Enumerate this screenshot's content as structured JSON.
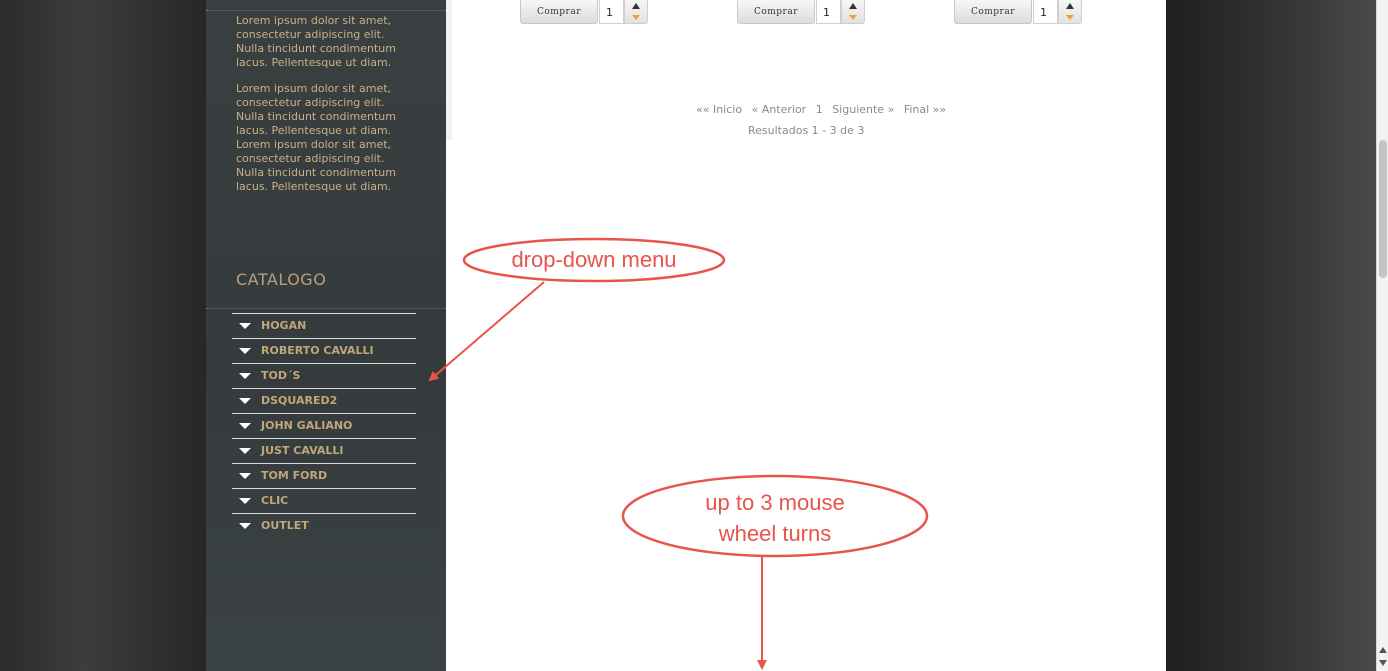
{
  "sidebar": {
    "paragraphs": [
      "Lorem ipsum dolor sit amet, consectetur adipiscing elit. Nulla tincidunt condimentum lacus. Pellentesque ut diam.",
      "Lorem ipsum dolor sit amet, consectetur adipiscing elit. Nulla tincidunt condimentum lacus. Pellentesque ut diam. Lorem ipsum dolor sit amet, consectetur adipiscing elit. Nulla tincidunt condimentum lacus. Pellentesque ut diam."
    ],
    "catalog_title": "CATALOGO",
    "catalog_items": [
      {
        "label": "HOGAN"
      },
      {
        "label": "ROBERTO CAVALLI"
      },
      {
        "label": "TOD´S"
      },
      {
        "label": "DSQUARED2"
      },
      {
        "label": "JOHN GALIANO"
      },
      {
        "label": "JUST CAVALLI"
      },
      {
        "label": "TOM FORD"
      },
      {
        "label": "CLIC"
      },
      {
        "label": "OUTLET"
      }
    ]
  },
  "products": [
    {
      "buy_label": "Comprar",
      "quantity": "1"
    },
    {
      "buy_label": "Comprar",
      "quantity": "1"
    },
    {
      "buy_label": "Comprar",
      "quantity": "1"
    }
  ],
  "pagination": {
    "first": "«« Inicio",
    "prev": "« Anterior",
    "page": "1",
    "next": "Siguiente »",
    "last": "Final »»",
    "results": "Resultados 1 - 3 de 3"
  },
  "annotations": {
    "dropdown_note": "drop-down menu",
    "scroll_note_line1": "up to 3 mouse",
    "scroll_note_line2": "wheel turns"
  },
  "colors": {
    "sidebar_text": "#c9b184",
    "annotation": "#e8534a",
    "menu_triangle": "#ffffff"
  }
}
